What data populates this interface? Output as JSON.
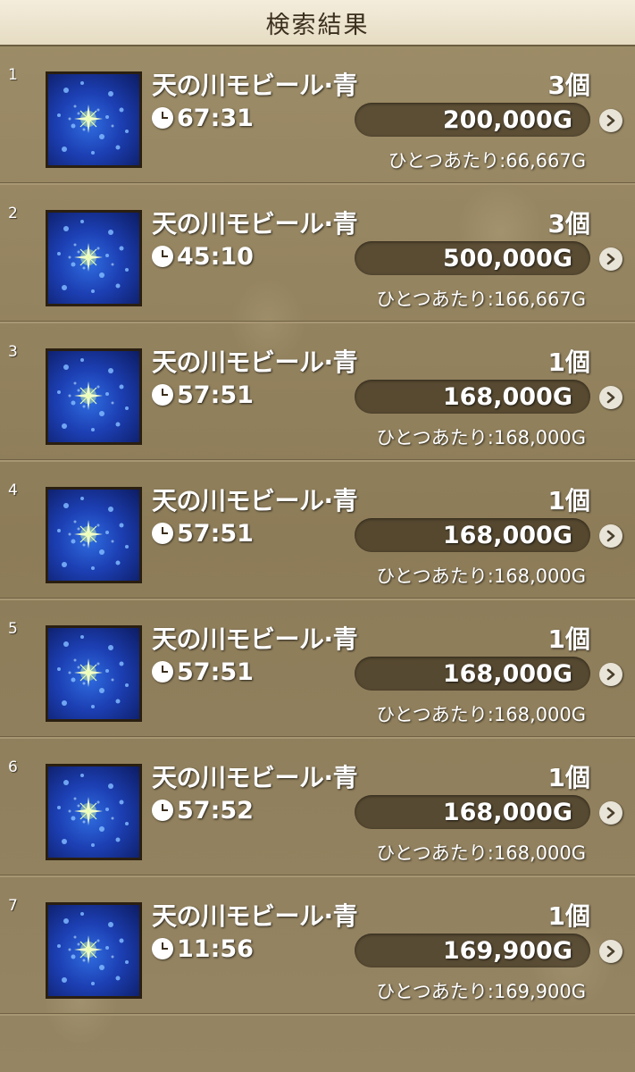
{
  "header": {
    "title": "検索結果"
  },
  "icons": {
    "timer": "clock-icon",
    "next": "chevron-right-icon"
  },
  "colors": {
    "header_bg": "#efe7d3",
    "panel_bg": "#8f7f5c",
    "pill_bg": "#3a2c17",
    "item_blue": "#1c3fb3"
  },
  "results": [
    {
      "index": "1",
      "name": "天の川モビール·青",
      "quantity": "3個",
      "time": "67:31",
      "price": "200,000G",
      "per_unit": "ひとつあたり:66,667G"
    },
    {
      "index": "2",
      "name": "天の川モビール·青",
      "quantity": "3個",
      "time": "45:10",
      "price": "500,000G",
      "per_unit": "ひとつあたり:166,667G"
    },
    {
      "index": "3",
      "name": "天の川モビール·青",
      "quantity": "1個",
      "time": "57:51",
      "price": "168,000G",
      "per_unit": "ひとつあたり:168,000G"
    },
    {
      "index": "4",
      "name": "天の川モビール·青",
      "quantity": "1個",
      "time": "57:51",
      "price": "168,000G",
      "per_unit": "ひとつあたり:168,000G"
    },
    {
      "index": "5",
      "name": "天の川モビール·青",
      "quantity": "1個",
      "time": "57:51",
      "price": "168,000G",
      "per_unit": "ひとつあたり:168,000G"
    },
    {
      "index": "6",
      "name": "天の川モビール·青",
      "quantity": "1個",
      "time": "57:52",
      "price": "168,000G",
      "per_unit": "ひとつあたり:168,000G"
    },
    {
      "index": "7",
      "name": "天の川モビール·青",
      "quantity": "1個",
      "time": "11:56",
      "price": "169,900G",
      "per_unit": "ひとつあたり:169,900G"
    }
  ]
}
